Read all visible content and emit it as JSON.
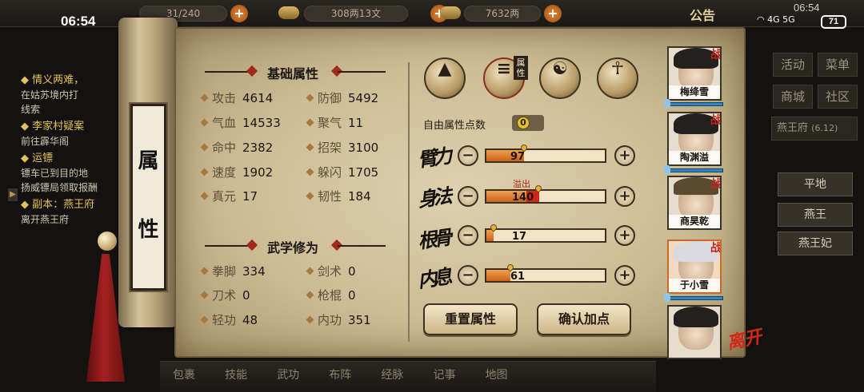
{
  "status_bar": {
    "time": "06:54",
    "time_small": "06:54",
    "network_icons": "4G 5G",
    "battery": "71"
  },
  "top_bar": {
    "stamina_text": "31/240",
    "money_text": "308两13文",
    "gold_text": "7632两",
    "notice_label": "公告"
  },
  "quests": [
    {
      "title": "情义两难，",
      "lines": [
        "在姑苏境内打",
        "线索"
      ]
    },
    {
      "title": "李家村疑案",
      "lines": [
        "前往霹华阁"
      ]
    },
    {
      "title": "运镖",
      "lines": [
        "镖车已到目的地",
        "扬威镖局领取报酬"
      ]
    },
    {
      "title": "副本：燕王府",
      "lines": [
        "离开燕王府"
      ]
    }
  ],
  "right_menu": {
    "buttons": [
      "活动",
      "菜单",
      "商城",
      "社区"
    ],
    "location": "燕王府",
    "coords": "(6.12)",
    "nearby": [
      "平地",
      "燕王",
      "燕王妃"
    ]
  },
  "bottom_nav": [
    "包裹",
    "技能",
    "武功",
    "布阵",
    "经脉",
    "记事",
    "地图"
  ],
  "panel": {
    "scroll_title": [
      "属",
      "性"
    ],
    "basic_title": "基础属性",
    "basic_stats": [
      {
        "label": "攻击",
        "value": "4614"
      },
      {
        "label": "防御",
        "value": "5492"
      },
      {
        "label": "气血",
        "value": "14533"
      },
      {
        "label": "聚气",
        "value": "11"
      },
      {
        "label": "命中",
        "value": "2382"
      },
      {
        "label": "招架",
        "value": "3100"
      },
      {
        "label": "速度",
        "value": "1902"
      },
      {
        "label": "躲闪",
        "value": "1705"
      },
      {
        "label": "真元",
        "value": "17"
      },
      {
        "label": "韧性",
        "value": "184"
      }
    ],
    "martial_title": "武学修为",
    "martial_stats": [
      {
        "label": "拳脚",
        "value": "334"
      },
      {
        "label": "剑术",
        "value": "0"
      },
      {
        "label": "刀术",
        "value": "0"
      },
      {
        "label": "枪棍",
        "value": "0"
      },
      {
        "label": "轻功",
        "value": "48"
      },
      {
        "label": "内功",
        "value": "351"
      }
    ],
    "tab_icons": [
      "portrait-icon",
      "attribute-scroll-icon",
      "taiji-icon",
      "meridian-body-icon"
    ],
    "active_tab_label": "属性",
    "free_points_label": "自由属性点数",
    "free_points_value": "0",
    "attributes": [
      {
        "name": "臂力",
        "value": "97",
        "fill": 0.32
      },
      {
        "name": "身法",
        "value": "140",
        "fill": 0.44,
        "overflow": true
      },
      {
        "name": "根骨",
        "value": "17",
        "fill": 0.06
      },
      {
        "name": "内息",
        "value": "61",
        "fill": 0.2
      }
    ],
    "overflow_label": "溢出",
    "reset_button": "重置属性",
    "confirm_button": "确认加点"
  },
  "characters": [
    {
      "name": "梅绛雪",
      "badge": "战"
    },
    {
      "name": "陶渊溢",
      "badge": "战"
    },
    {
      "name": "商昊乾",
      "badge": "战"
    },
    {
      "name": "于小雪",
      "badge": "战"
    },
    {
      "name": "",
      "badge": ""
    }
  ],
  "leave_label": "离开",
  "colors": {
    "accent_red": "#c8231a",
    "bar_orange": "#c9641c",
    "paper": "#d6c8a4"
  }
}
